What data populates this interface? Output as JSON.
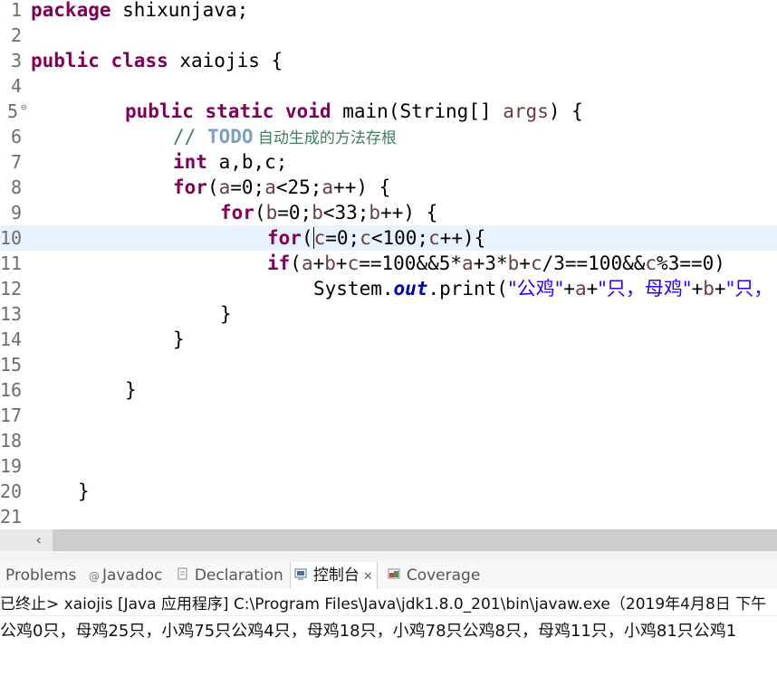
{
  "editor": {
    "line_numbers": [
      "1",
      "2",
      "3",
      "4",
      "5",
      "6",
      "7",
      "8",
      "9",
      "10",
      "11",
      "12",
      "13",
      "14",
      "15",
      "16",
      "17",
      "18",
      "19",
      "20",
      "21"
    ],
    "fold_marker": "⊖",
    "l1": {
      "kw": "package",
      "rest": " shixunjava;"
    },
    "l3": {
      "kw1": "public",
      "kw2": "class",
      "rest": " xaiojis {"
    },
    "l5": {
      "kw1": "public",
      "kw2": "static",
      "kw3": "void",
      "rest": " main(String[] ",
      "param": "args",
      "end": ") {"
    },
    "l6": {
      "slashes": "// ",
      "todo": "TODO",
      "text": " 自动生成的方法存根"
    },
    "l7": {
      "kw": "int",
      "rest": " a,b,c;"
    },
    "l8": {
      "kw": "for",
      "p1": "(",
      "v1": "a",
      "p2": "=0;",
      "v2": "a",
      "p3": "<25;",
      "v3": "a",
      "p4": "++) {"
    },
    "l9": {
      "kw": "for",
      "p1": "(",
      "v1": "b",
      "p2": "=0;",
      "v2": "b",
      "p3": "<33;",
      "v3": "b",
      "p4": "++) {"
    },
    "l10": {
      "kw": "for",
      "p1": "(",
      "v1": "c",
      "p2": "=0;",
      "v2": "c",
      "p3": "<100;",
      "v3": "c",
      "p4": "++){"
    },
    "l11": {
      "kw": "if",
      "p1": "(",
      "v1": "a",
      "p2": "+",
      "v2": "b",
      "p3": "+",
      "v3": "c",
      "p4": "==100&&5*",
      "v4": "a",
      "p5": "+3*",
      "v5": "b",
      "p6": "+",
      "v6": "c",
      "p7": "/3==100&&",
      "v7": "c",
      "p8": "%3==0)"
    },
    "l12": {
      "p1": "System.",
      "field": "out",
      "p2": ".print(",
      "s1": "\"公鸡\"",
      "p3": "+",
      "v1": "a",
      "p4": "+",
      "s2": "\"只，母鸡\"",
      "p5": "+",
      "v2": "b",
      "p6": "+",
      "s3": "\"只，"
    },
    "brace": "}"
  },
  "tabs": {
    "problems": "Problems",
    "javadoc": "Javadoc",
    "declaration": "Declaration",
    "console": "控制台",
    "coverage": "Coverage",
    "javadoc_icon": "@",
    "close_glyph": "✕"
  },
  "console": {
    "status": "已终止> xaiojis [Java 应用程序] C:\\Program Files\\Java\\jdk1.8.0_201\\bin\\javaw.exe（2019年4月8日 下午",
    "output": "公鸡0只，母鸡25只，小鸡75只公鸡4只，母鸡18只，小鸡78只公鸡8只，母鸡11只，小鸡81只公鸡1"
  },
  "scrollbar": {
    "left_arrow": "‹"
  },
  "colors": {
    "keyword": "#7f0055",
    "comment": "#3f7f5f",
    "string": "#2a00ff",
    "local_var": "#6a3e3e",
    "static_field": "#0000c0",
    "current_line": "#e8f2fe"
  }
}
